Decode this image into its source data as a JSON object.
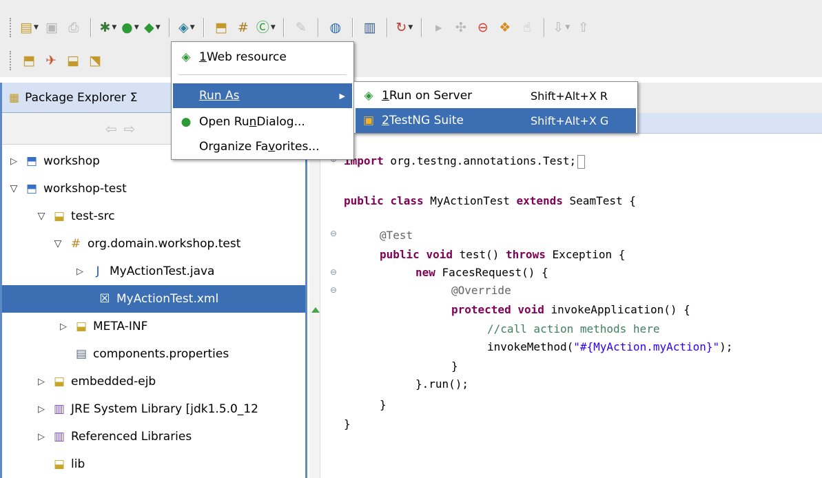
{
  "explorer": {
    "title": "Package Explorer",
    "close_glyph": "Σ",
    "nav_back": "⇦",
    "nav_forward": "⇨",
    "tree": [
      {
        "label": "workshop",
        "icon": "project-icon"
      },
      {
        "label": "workshop-test",
        "icon": "project-icon"
      },
      {
        "label": "test-src",
        "icon": "source-folder-icon"
      },
      {
        "label": "org.domain.workshop.test",
        "icon": "package-icon"
      },
      {
        "label": "MyActionTest.java",
        "icon": "java-file-icon"
      },
      {
        "label": "MyActionTest.xml",
        "icon": "xml-file-icon"
      },
      {
        "label": "META-INF",
        "icon": "folder-icon"
      },
      {
        "label": "components.properties",
        "icon": "properties-file-icon"
      },
      {
        "label": "embedded-ejb",
        "icon": "source-folder-icon"
      },
      {
        "label": "JRE System Library [jdk1.5.0_12",
        "icon": "library-icon"
      },
      {
        "label": "Referenced Libraries",
        "icon": "library-icon"
      },
      {
        "label": "lib",
        "icon": "folder-icon"
      }
    ]
  },
  "menu": {
    "web_resource": {
      "number": "1",
      "label": " Web resource"
    },
    "run_as": {
      "label": "Run As"
    },
    "open_run_dialog": {
      "before": "Open Ru",
      "mnemonic": "n",
      "after": " Dialog..."
    },
    "organize_favorites": {
      "before": "Organize Fa",
      "mnemonic": "v",
      "after": "orites..."
    }
  },
  "submenu": {
    "run_on_server": {
      "number": "1",
      "label": " Run on Server",
      "shortcut": "Shift+Alt+X R"
    },
    "testng_suite": {
      "number": "2",
      "label": " TestNG Suite",
      "shortcut": "Shift+Alt+X G"
    }
  },
  "code": {
    "l1_kw": "import",
    "l1_rest": " org.testng.annotations.Test;",
    "l2_kw1": "public",
    "l2_sp1": " ",
    "l2_kw2": "class",
    "l2_name": " MyActionTest ",
    "l2_kw3": "extends",
    "l2_rest": " SeamTest {",
    "l3_ann": "@Test",
    "l4_kw1": "public",
    "l4_sp": " ",
    "l4_kw2": "void",
    "l4_mid": " test() ",
    "l4_kw3": "throws",
    "l4_rest": " Exception {",
    "l5_kw": "new",
    "l5_rest": " FacesRequest() {",
    "l6_ann": "@Override",
    "l7_kw1": "protected",
    "l7_sp": " ",
    "l7_kw2": "void",
    "l7_rest": " invokeApplication() {",
    "l8_cmt": "//call action methods here",
    "l9_pre": "invokeMethod(",
    "l9_str": "\"#{MyAction.myAction}\"",
    "l9_post": ");",
    "l10": "}",
    "l11": "}.run();",
    "l12": "}",
    "l13": "}"
  },
  "colors": {
    "selection": "#3c6eb4",
    "keyword": "#7f0055",
    "comment": "#3f7f5f",
    "string": "#2a00ff",
    "annotation": "#646464"
  }
}
